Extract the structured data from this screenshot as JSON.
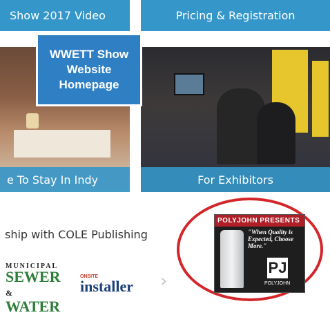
{
  "tiles": {
    "video": "Show 2017 Video",
    "pricing": "Pricing & Registration",
    "stay": "e To Stay In Indy",
    "exhibitors": "For Exhibitors"
  },
  "callout": "WWETT Show Website Homepage",
  "partner_text": "ship with COLE Publishing",
  "logos": {
    "msw_top": "MUNICIPAL",
    "msw_sewer": "SEWER",
    "msw_amp": "&",
    "msw_water": "WATER",
    "installer_small": "ONSITE",
    "installer": "installer"
  },
  "ad": {
    "banner": "POLYJOHN PRESENTS",
    "quote": "\"When Quality is Expected, Choose More.\"",
    "brandmark": "PJ",
    "brandname": "POLYJOHN"
  },
  "colors": {
    "tile_caption": "#3496c8",
    "callout": "#2f7fc4",
    "oval": "#d3262b"
  },
  "icons": {
    "carousel_next": "chevron-right-icon"
  }
}
